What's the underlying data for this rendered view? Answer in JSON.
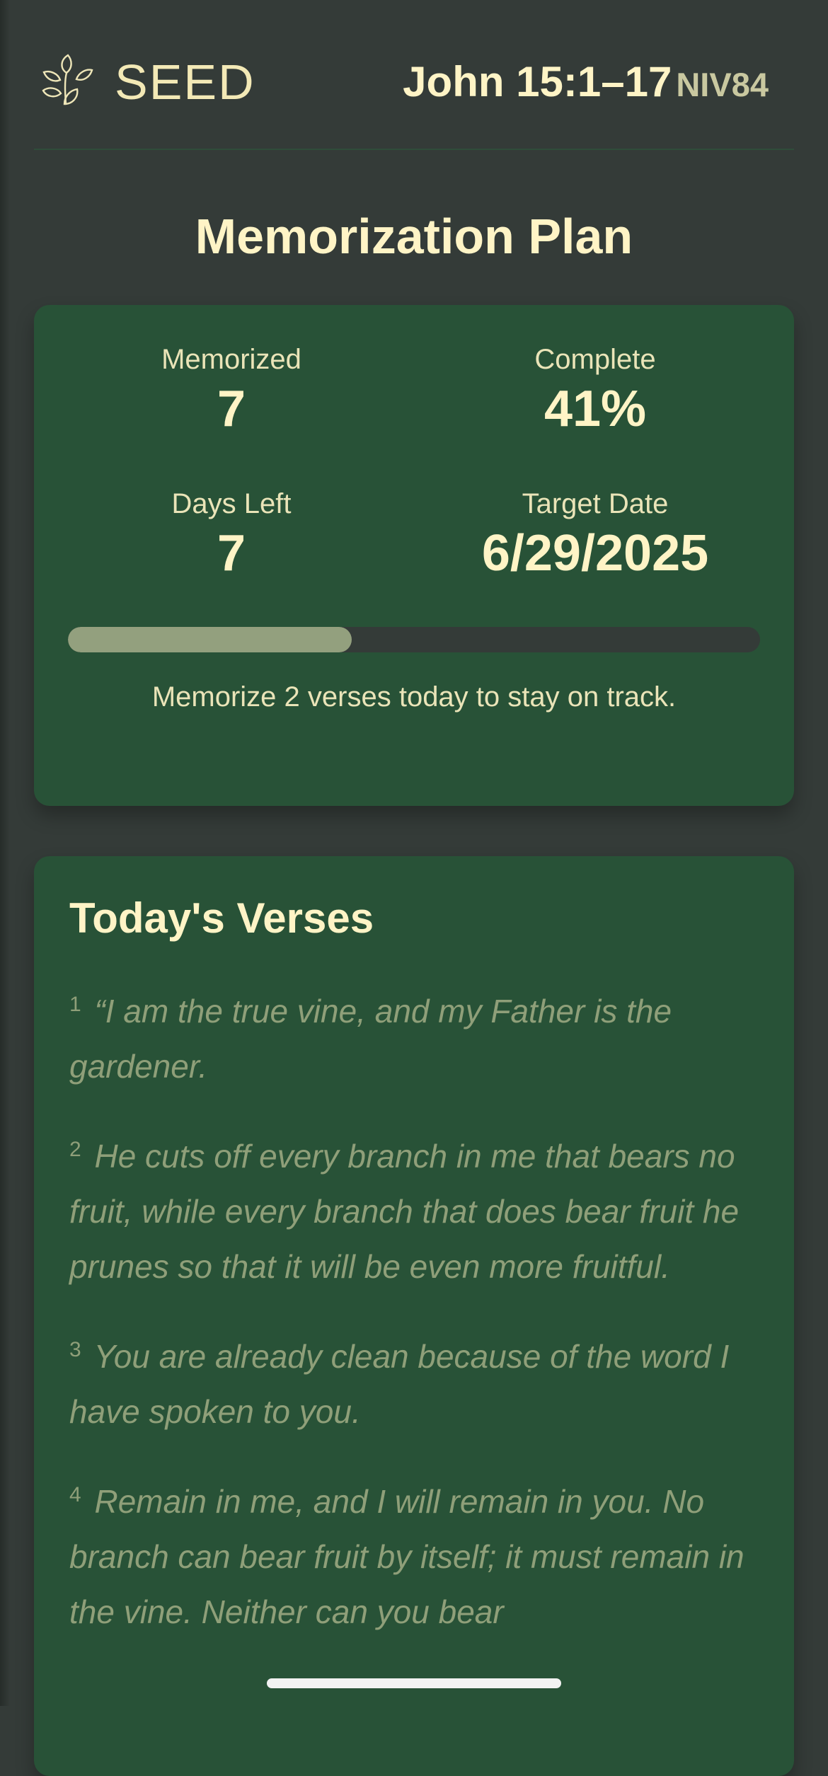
{
  "header": {
    "brand": "SEED",
    "passage_ref": "John 15:1–17",
    "passage_version": "NIV84"
  },
  "plan": {
    "title": "Memorization Plan",
    "stats": [
      {
        "label": "Memorized",
        "value": "7"
      },
      {
        "label": "Complete",
        "value": "41%"
      },
      {
        "label": "Days Left",
        "value": "7"
      },
      {
        "label": "Target Date",
        "value": "6/29/2025"
      }
    ],
    "progress_percent": 41,
    "message": "Memorize 2 verses today to stay on track."
  },
  "today": {
    "title": "Today's Verses",
    "verses": [
      {
        "num": "1",
        "text": "“I am the true vine, and my Father is the gardener."
      },
      {
        "num": "2",
        "text": "He cuts off every branch in me that bears no fruit, while every branch that does bear fruit he prunes so that it will be even more fruitful."
      },
      {
        "num": "3",
        "text": "You are already clean because of the word I have spoken to you."
      },
      {
        "num": "4",
        "text": "Remain in me, and I will remain in you. No branch can bear fruit by itself; it must remain in the vine. Neither can you bear"
      }
    ]
  },
  "colors": {
    "background": "#343b38",
    "card": "#285237",
    "accent_text": "#fff4c6",
    "verse_text": "#8f9f79",
    "progress_fill": "#93a07e"
  },
  "icons": {
    "logo": "seed-leaves-icon"
  }
}
